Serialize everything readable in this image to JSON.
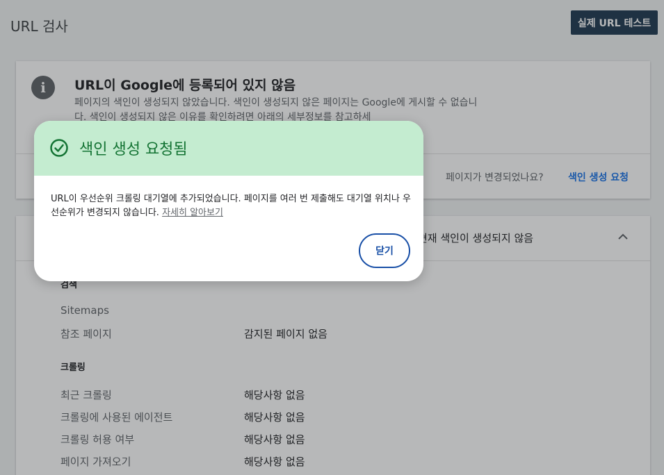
{
  "header": {
    "title": "URL 검사",
    "live_test_label": "실제 URL 테스트"
  },
  "status_card": {
    "icon": "info-icon",
    "title": "URL이 Google에 등록되어 있지 않음",
    "description": "페이지의 색인이 생성되지 않았습니다. 색인이 생성되지 않은 페이지는 Google에 게시할 수 없습니다. 색인이 생성되지 않은 이유를 확인하려면 아래의 세부정보를 참고하세",
    "changed_question": "페이지가 변경되었나요?",
    "request_indexing_label": "색인 생성 요청"
  },
  "details_card": {
    "summary": "현재 색인이 생성되지 않음",
    "discovery_title": "검색",
    "discovery_rows": [
      {
        "label": "Sitemaps",
        "value": ""
      },
      {
        "label": "참조 페이지",
        "value": "감지된 페이지 없음"
      }
    ],
    "crawl_title": "크롤링",
    "crawl_rows": [
      {
        "label": "최근 크롤링",
        "value": "해당사항 없음"
      },
      {
        "label": "크롤링에 사용된 에이전트",
        "value": "해당사항 없음"
      },
      {
        "label": "크롤링 허용 여부",
        "value": "해당사항 없음"
      },
      {
        "label": "페이지 가져오기",
        "value": "해당사항 없음"
      }
    ]
  },
  "dialog": {
    "icon": "check-circle-icon",
    "title": "색인 생성 요청됨",
    "body": "URL이 우선순위 크롤링 대기열에 추가되었습니다. 페이지를 여러 번 제출해도 대기열 위치나 우선순위가 변경되지 않습니다. ",
    "learn_more": "자세히 알아보기",
    "close_label": "닫기"
  },
  "colors": {
    "dialog_header_bg": "#c4ecd0",
    "dialog_title": "#137333",
    "primary_button": "#1f3a52",
    "accent_blue": "#174ea6"
  }
}
